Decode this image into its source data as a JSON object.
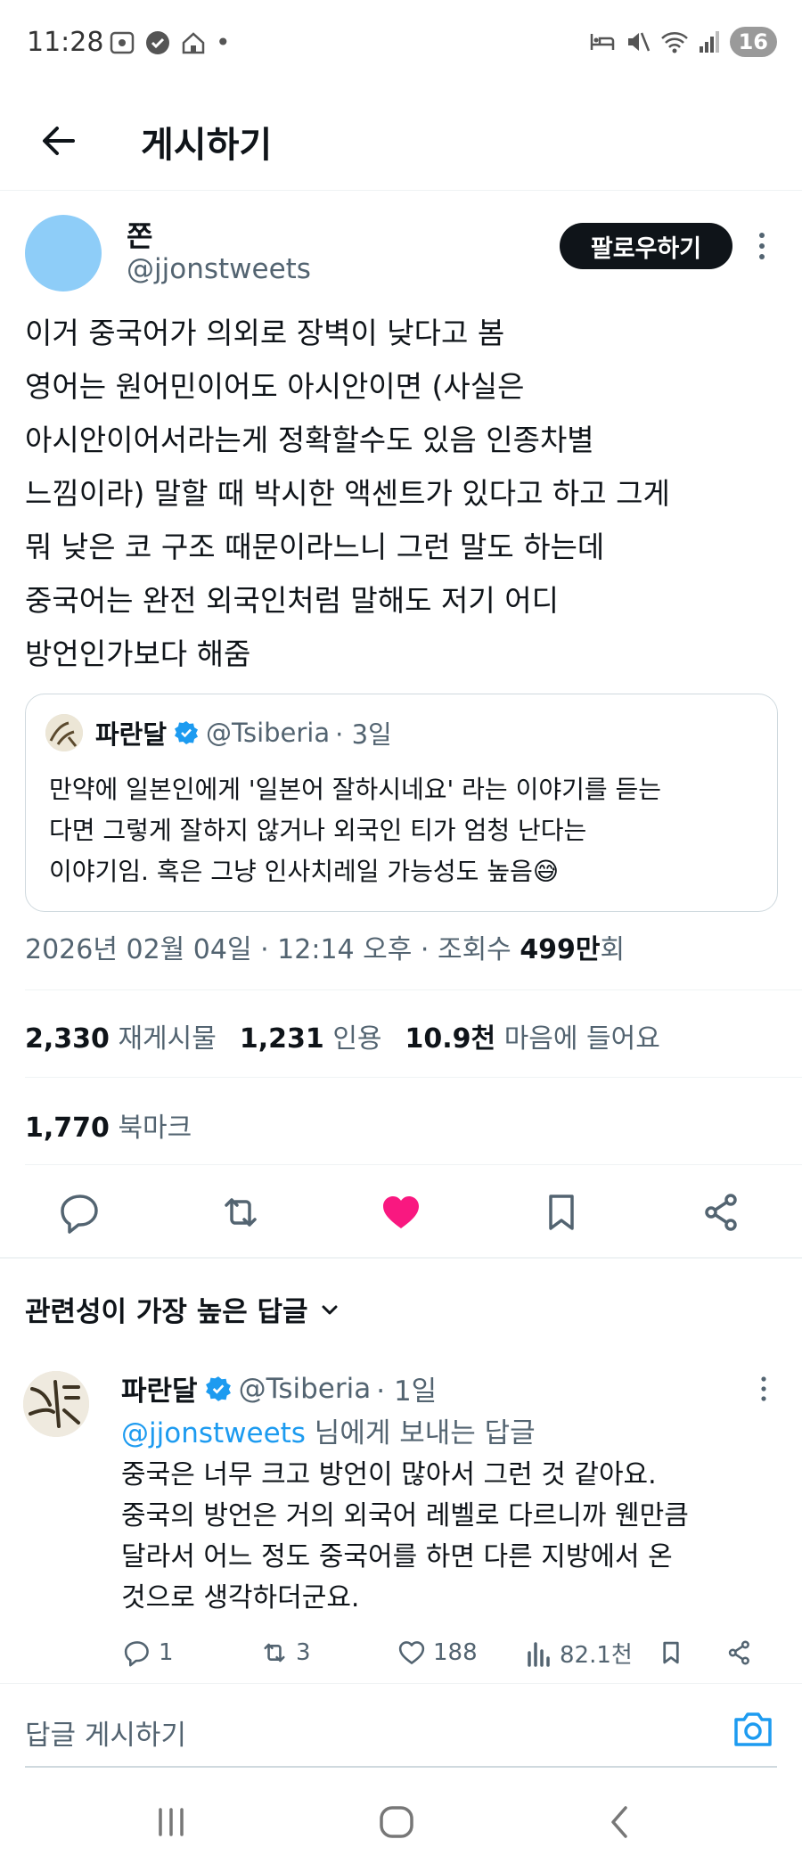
{
  "status_bar": {
    "time": "11:28",
    "battery": "16"
  },
  "header": {
    "title": "게시하기"
  },
  "post": {
    "author_name": "쫀",
    "author_handle": "@jjonstweets",
    "follow_label": "팔로우하기",
    "text": "이거 중국어가 의외로 장벽이 낮다고 봄\n영어는 원어민이어도 아시안이면 (사실은\n아시안이어서라는게 정확할수도 있음 인종차별\n느낌이라) 말할 때 박시한 액센트가 있다고 하고 그게\n뭐 낮은 코 구조 때문이라느니 그런 말도 하는데\n중국어는 완전 외국인처럼 말해도 저기 어디\n방언인가보다 해줌",
    "quote": {
      "name": "파란달",
      "handle": "@Tsiberia",
      "time": "· 3일",
      "text": "만약에 일본인에게 '일본어 잘하시네요' 라는 이야기를 듣는\n다면 그렇게 잘하지 않거나 외국인 티가 엄청 난다는\n이야기임. 혹은 그냥 인사치레일 가능성도 높음😅"
    },
    "timestamp": "2026년 02월 04일 · 12:14 오후 · 조회수 ",
    "views": "499만",
    "views_suffix": "회",
    "stats": {
      "reposts_count": "2,330",
      "reposts_label": "재게시물",
      "quotes_count": "1,231",
      "quotes_label": "인용",
      "likes_count": "10.9천",
      "likes_label": "마음에 들어요",
      "bookmarks_count": "1,770",
      "bookmarks_label": "북마크"
    }
  },
  "replies_section": {
    "sort_label": "관련성이 가장 높은 답글"
  },
  "reply": {
    "name": "파란달",
    "handle": "@Tsiberia",
    "time": "· 1일",
    "reply_to_handle": "@jjonstweets",
    "reply_to_suffix": " 님에게 보내는 답글",
    "text": "중국은 너무 크고 방언이 많아서 그런 것 같아요.\n중국의 방언은 거의 외국어 레벨로 다르니까 웬만큼\n달라서 어느 정도 중국어를 하면 다른 지방에서 온\n것으로 생각하더군요.",
    "replies": "1",
    "reposts": "3",
    "likes": "188",
    "views": "82.1천"
  },
  "compose": {
    "placeholder": "답글 게시하기"
  },
  "colors": {
    "accent": "#1d9bf0",
    "like": "#f91880",
    "text": "#0f1419",
    "muted": "#536471"
  }
}
